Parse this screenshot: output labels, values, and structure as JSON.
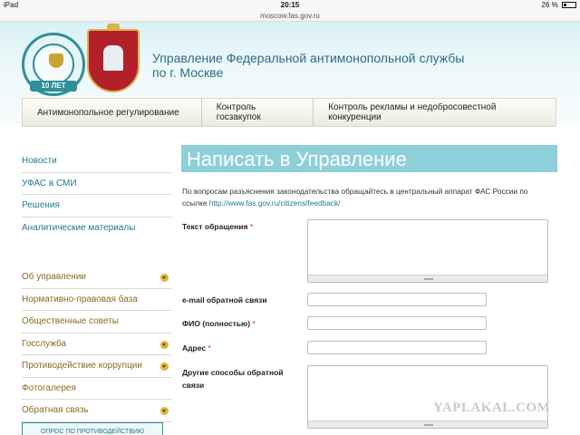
{
  "statusbar": {
    "device": "iPad",
    "time": "20:15",
    "battery": "26 %"
  },
  "browser": {
    "url": "moscow.fas.gov.ru"
  },
  "header": {
    "org_name_line1": "Управление Федеральной антимонопольной службы",
    "org_name_line2": "по г. Москве",
    "anniversary_label": "10 ЛЕТ"
  },
  "topnav": {
    "items": [
      "Антимонопольное регулирование",
      "Контроль госзакупок",
      "Контроль рекламы и недобросовестной конкуренции"
    ]
  },
  "sidebar": {
    "group1": [
      "Новости",
      "УФАС в СМИ",
      "Решения",
      "Аналитические материалы"
    ],
    "group2": [
      {
        "label": "Об управлении",
        "expandable": true
      },
      {
        "label": "Нормативно-правовая база",
        "expandable": false
      },
      {
        "label": "Общественные советы",
        "expandable": false
      },
      {
        "label": "Госслужба",
        "expandable": true
      },
      {
        "label": "Противодействие коррупции",
        "expandable": true
      },
      {
        "label": "Фотогалерея",
        "expandable": false
      },
      {
        "label": "Обратная связь",
        "expandable": true
      }
    ],
    "promo": "ОПРОС ПО ПРОТИВОДЕЙСТВИЮ КОРРУПЦИИ"
  },
  "main": {
    "title": "Написать в Управление",
    "intro_text": "По вопросам разъяснения законодательства обращайтесь в центральный аппарат ФАС России по ссылке",
    "intro_link": "http://www.fas.gov.ru/citizens/feedback/",
    "form": {
      "message_label": "Текст обращения",
      "email_label": "e-mail обратной связи",
      "name_label": "ФИО (полностью)",
      "address_label": "Адрес",
      "other_label_line1": "Другие способы обратной",
      "other_label_line2": "связи",
      "required_mark": "*"
    }
  },
  "watermark": "YAPLAKAL.COM"
}
